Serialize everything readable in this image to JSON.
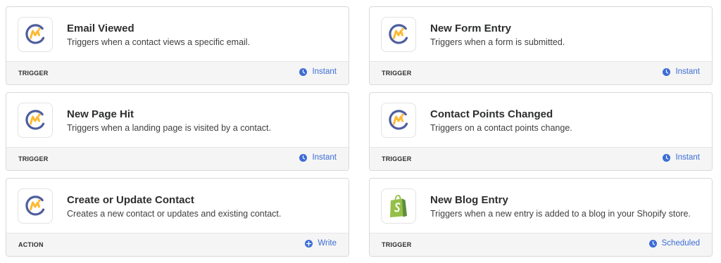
{
  "colors": {
    "accent_blue": "#3d6dd6",
    "mautic_navy": "#4e5e9e",
    "mautic_orange": "#fdb933",
    "shopify_green": "#95bf47",
    "footer_bg": "#f5f5f5"
  },
  "cards": [
    {
      "app": "mautic-icon",
      "title": "Email Viewed",
      "description": "Triggers when a contact views a specific email.",
      "type": "TRIGGER",
      "mode": "Instant",
      "mode_icon": "clock-icon"
    },
    {
      "app": "mautic-icon",
      "title": "New Form Entry",
      "description": "Triggers when a form is submitted.",
      "type": "TRIGGER",
      "mode": "Instant",
      "mode_icon": "clock-icon"
    },
    {
      "app": "mautic-icon",
      "title": "New Page Hit",
      "description": "Triggers when a landing page is visited by a contact.",
      "type": "TRIGGER",
      "mode": "Instant",
      "mode_icon": "clock-icon"
    },
    {
      "app": "mautic-icon",
      "title": "Contact Points Changed",
      "description": "Triggers on a contact points change.",
      "type": "TRIGGER",
      "mode": "Instant",
      "mode_icon": "clock-icon"
    },
    {
      "app": "mautic-icon",
      "title": "Create or Update Contact",
      "description": "Creates a new contact or updates and existing contact.",
      "type": "ACTION",
      "mode": "Write",
      "mode_icon": "write-icon"
    },
    {
      "app": "shopify-icon",
      "title": "New Blog Entry",
      "description": "Triggers when a new entry is added to a blog in your Shopify store.",
      "type": "TRIGGER",
      "mode": "Scheduled",
      "mode_icon": "clock-icon"
    }
  ]
}
